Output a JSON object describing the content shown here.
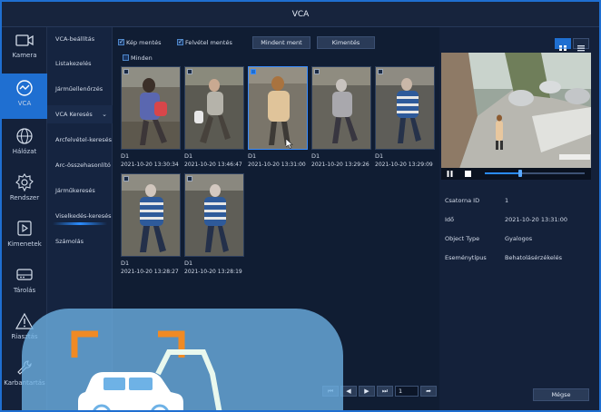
{
  "window": {
    "title": "VCA"
  },
  "iconbar": [
    {
      "label": "Kamera",
      "icon": "camera-icon"
    },
    {
      "label": "VCA",
      "icon": "vca-icon",
      "active": true
    },
    {
      "label": "Hálózat",
      "icon": "globe-icon"
    },
    {
      "label": "Rendszer",
      "icon": "gear-icon"
    },
    {
      "label": "Kimenetek",
      "icon": "playback-icon"
    },
    {
      "label": "Tárolás",
      "icon": "storage-icon"
    },
    {
      "label": "Riasztás",
      "icon": "alarm-icon"
    },
    {
      "label": "Karbantartás",
      "icon": "wrench-icon"
    }
  ],
  "submenu": {
    "items": [
      {
        "label": "VCA-beállítás"
      },
      {
        "label": "Listakezelés"
      },
      {
        "label": "Járműellenőrzés"
      },
      {
        "label": "VCA Keresés",
        "chevron": "⌄"
      },
      {
        "label": "Arcfelvétel-keresés"
      },
      {
        "label": "Arc-összehasonlító k..."
      },
      {
        "label": "Járműkeresés"
      },
      {
        "label": "Viselkedés-keresés"
      },
      {
        "label": "Számolás"
      }
    ]
  },
  "toolbar": {
    "save_images": "Kép mentés",
    "save_recording": "Felvétel mentés",
    "save_all": "Mindent ment",
    "export": "Kimentés",
    "select_all": "Minden"
  },
  "results": [
    {
      "channel": "D1",
      "time": "2021-10-20 13:30:34",
      "checked": false
    },
    {
      "channel": "D1",
      "time": "2021-10-20 13:46:47",
      "checked": false
    },
    {
      "channel": "D1",
      "time": "2021-10-20 13:31:00",
      "checked": true
    },
    {
      "channel": "D1",
      "time": "2021-10-20 13:29:26",
      "checked": false
    },
    {
      "channel": "D1",
      "time": "2021-10-20 13:29:09",
      "checked": false
    },
    {
      "channel": "D1",
      "time": "2021-10-20 13:28:27",
      "checked": false
    },
    {
      "channel": "D1",
      "time": "2021-10-20 13:28:19",
      "checked": false
    }
  ],
  "pager": {
    "page": "1"
  },
  "detail": {
    "channel_id_label": "Csatorna ID",
    "channel_id": "1",
    "time_label": "Idő",
    "time": "2021-10-20 13:31:00",
    "object_type_label": "Object Type",
    "object_type": "Gyalogos",
    "event_type_label": "Eseménytípus",
    "event_type": "Behatolásérzékelés",
    "cancel": "Mégse",
    "playback_progress": 0.35
  },
  "colors": {
    "accent": "#1f6fd1",
    "background": "#101d33",
    "panel": "#14213a"
  }
}
